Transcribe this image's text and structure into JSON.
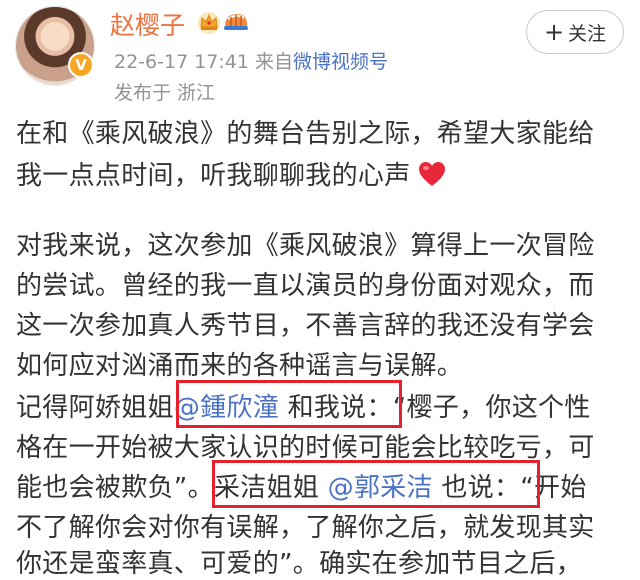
{
  "user": {
    "name": "赵樱子",
    "date": "22-6-17",
    "time": "17:41",
    "source_prefix": "来自",
    "source": "微博视频号",
    "published_from": "发布于 浙江",
    "follow_label": "关注",
    "follow_icon": "+"
  },
  "post": {
    "line1": "在和《乘风破浪》的舞台告别之际，希望大家能给",
    "line2": "我一点点时间，听我聊聊我的心声",
    "line3": "对我来说，这次参加《乘风破浪》算得上一次冒险",
    "line4": "的尝试。曾经的我一直以演员的身份面对观众，而",
    "line5": "这一次参加真人秀节目，不善言辞的我还没有学会",
    "line6": "如何应对汹涌而来的各种谣言与误解。",
    "line7_a": "记得阿娇姐姐",
    "line7_mention": "@鍾欣潼",
    "line7_b": " 和我说：“樱子，你这个性",
    "line8": "格在一开始被大家认识的时候可能会比较吃亏，可",
    "line9_a": "能也会被欺负”。",
    "line9_b": "采洁姐姐 ",
    "line9_mention": "@郭采洁",
    "line9_c": " 也说：“开始",
    "line10": "不了解你会对你有误解，了解你之后，就发现其实",
    "line11": "你还是蛮率真、可爱的”。确实在参加节目之后，"
  },
  "colors": {
    "name": "#eb7340",
    "mention": "#4b72c4",
    "highlight_box": "#e4212c",
    "meta": "#939393"
  },
  "icons": [
    "crown-icon",
    "helmet-icon",
    "verified-badge-icon",
    "plus-icon",
    "heart-icon"
  ]
}
